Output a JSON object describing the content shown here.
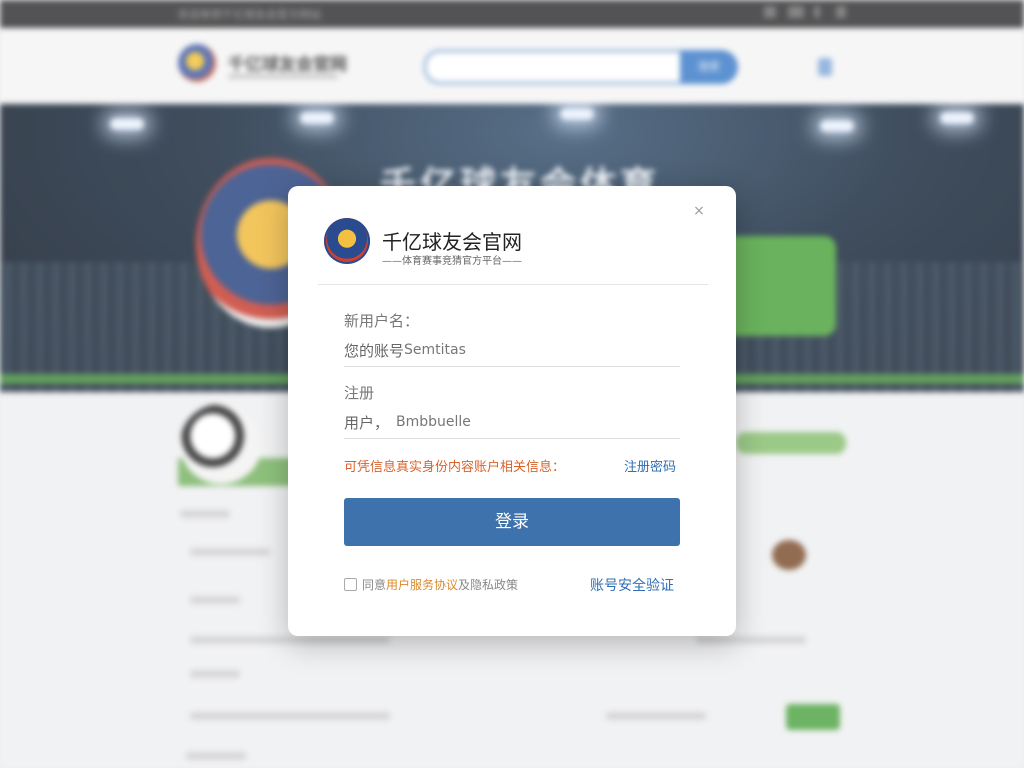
{
  "background": {
    "topbar_text": "欢迎来到千亿球友会官方网站",
    "site_name": "千亿球友会官网",
    "search_button": "搜索",
    "banner_title": "千亿球友会体育"
  },
  "modal": {
    "title": "千亿球友会官网",
    "subtitle": "——体育赛事竞猜官方平台——",
    "close_icon": "×",
    "username_label": "新用户名：",
    "username_prefix": "您的账号",
    "username_value": "Semtitas",
    "register_label": "注册",
    "user_prefix": "用户，",
    "user_value": "Bmbbuelle",
    "notice_prefix": "可凭信息真实身份",
    "notice_suffix": "内容账户相关信息：",
    "register_password_link": "注册密码",
    "login_button": "登录",
    "agree_prefix": "同意",
    "agree_highlight": "用户服务协议",
    "agree_suffix": "及隐私政策",
    "security_link": "账号安全验证"
  },
  "colors": {
    "accent_blue": "#3d72ad",
    "notice_orange": "#d9622b",
    "link_blue": "#2f6eb5"
  }
}
